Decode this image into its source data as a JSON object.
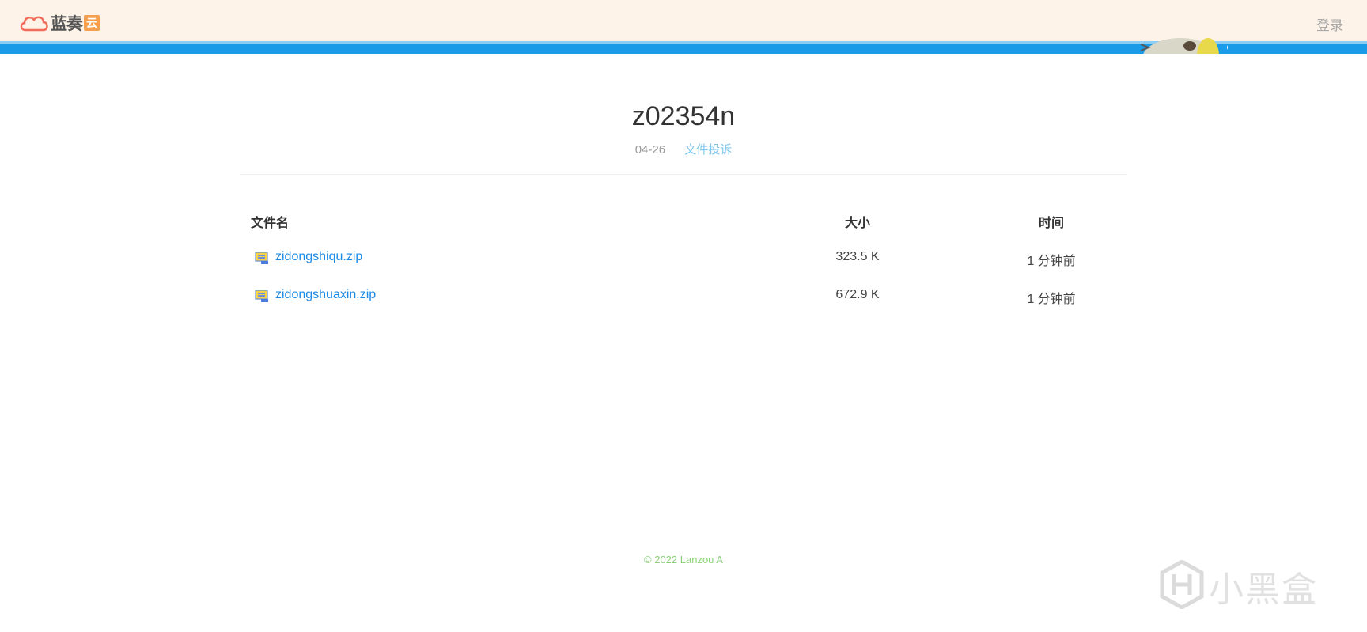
{
  "header": {
    "logo_text": "蓝奏",
    "logo_badge": "云",
    "login_label": "登录"
  },
  "folder": {
    "title": "z02354n",
    "date": "04-26",
    "report_label": "文件投诉"
  },
  "table": {
    "headers": {
      "name": "文件名",
      "size": "大小",
      "time": "时间"
    },
    "rows": [
      {
        "name": "zidongshiqu.zip",
        "size": "323.5 K",
        "time": "1 分钟前"
      },
      {
        "name": "zidongshuaxin.zip",
        "size": "672.9 K",
        "time": "1 分钟前"
      }
    ]
  },
  "footer": {
    "copyright": "© 2022 Lanzou A"
  },
  "watermark": {
    "text": "小黑盒"
  },
  "colors": {
    "header_bg": "#fdf3e8",
    "accent_blue": "#1a9be8",
    "link": "#1a8ae8",
    "footer_green": "#8cd17a",
    "logo_red": "#f26b5b",
    "logo_orange": "#f6a04d"
  },
  "icons": {
    "logo": "cloud-icon",
    "file": "archive-file-icon",
    "watermark": "heybox-logo-icon"
  }
}
